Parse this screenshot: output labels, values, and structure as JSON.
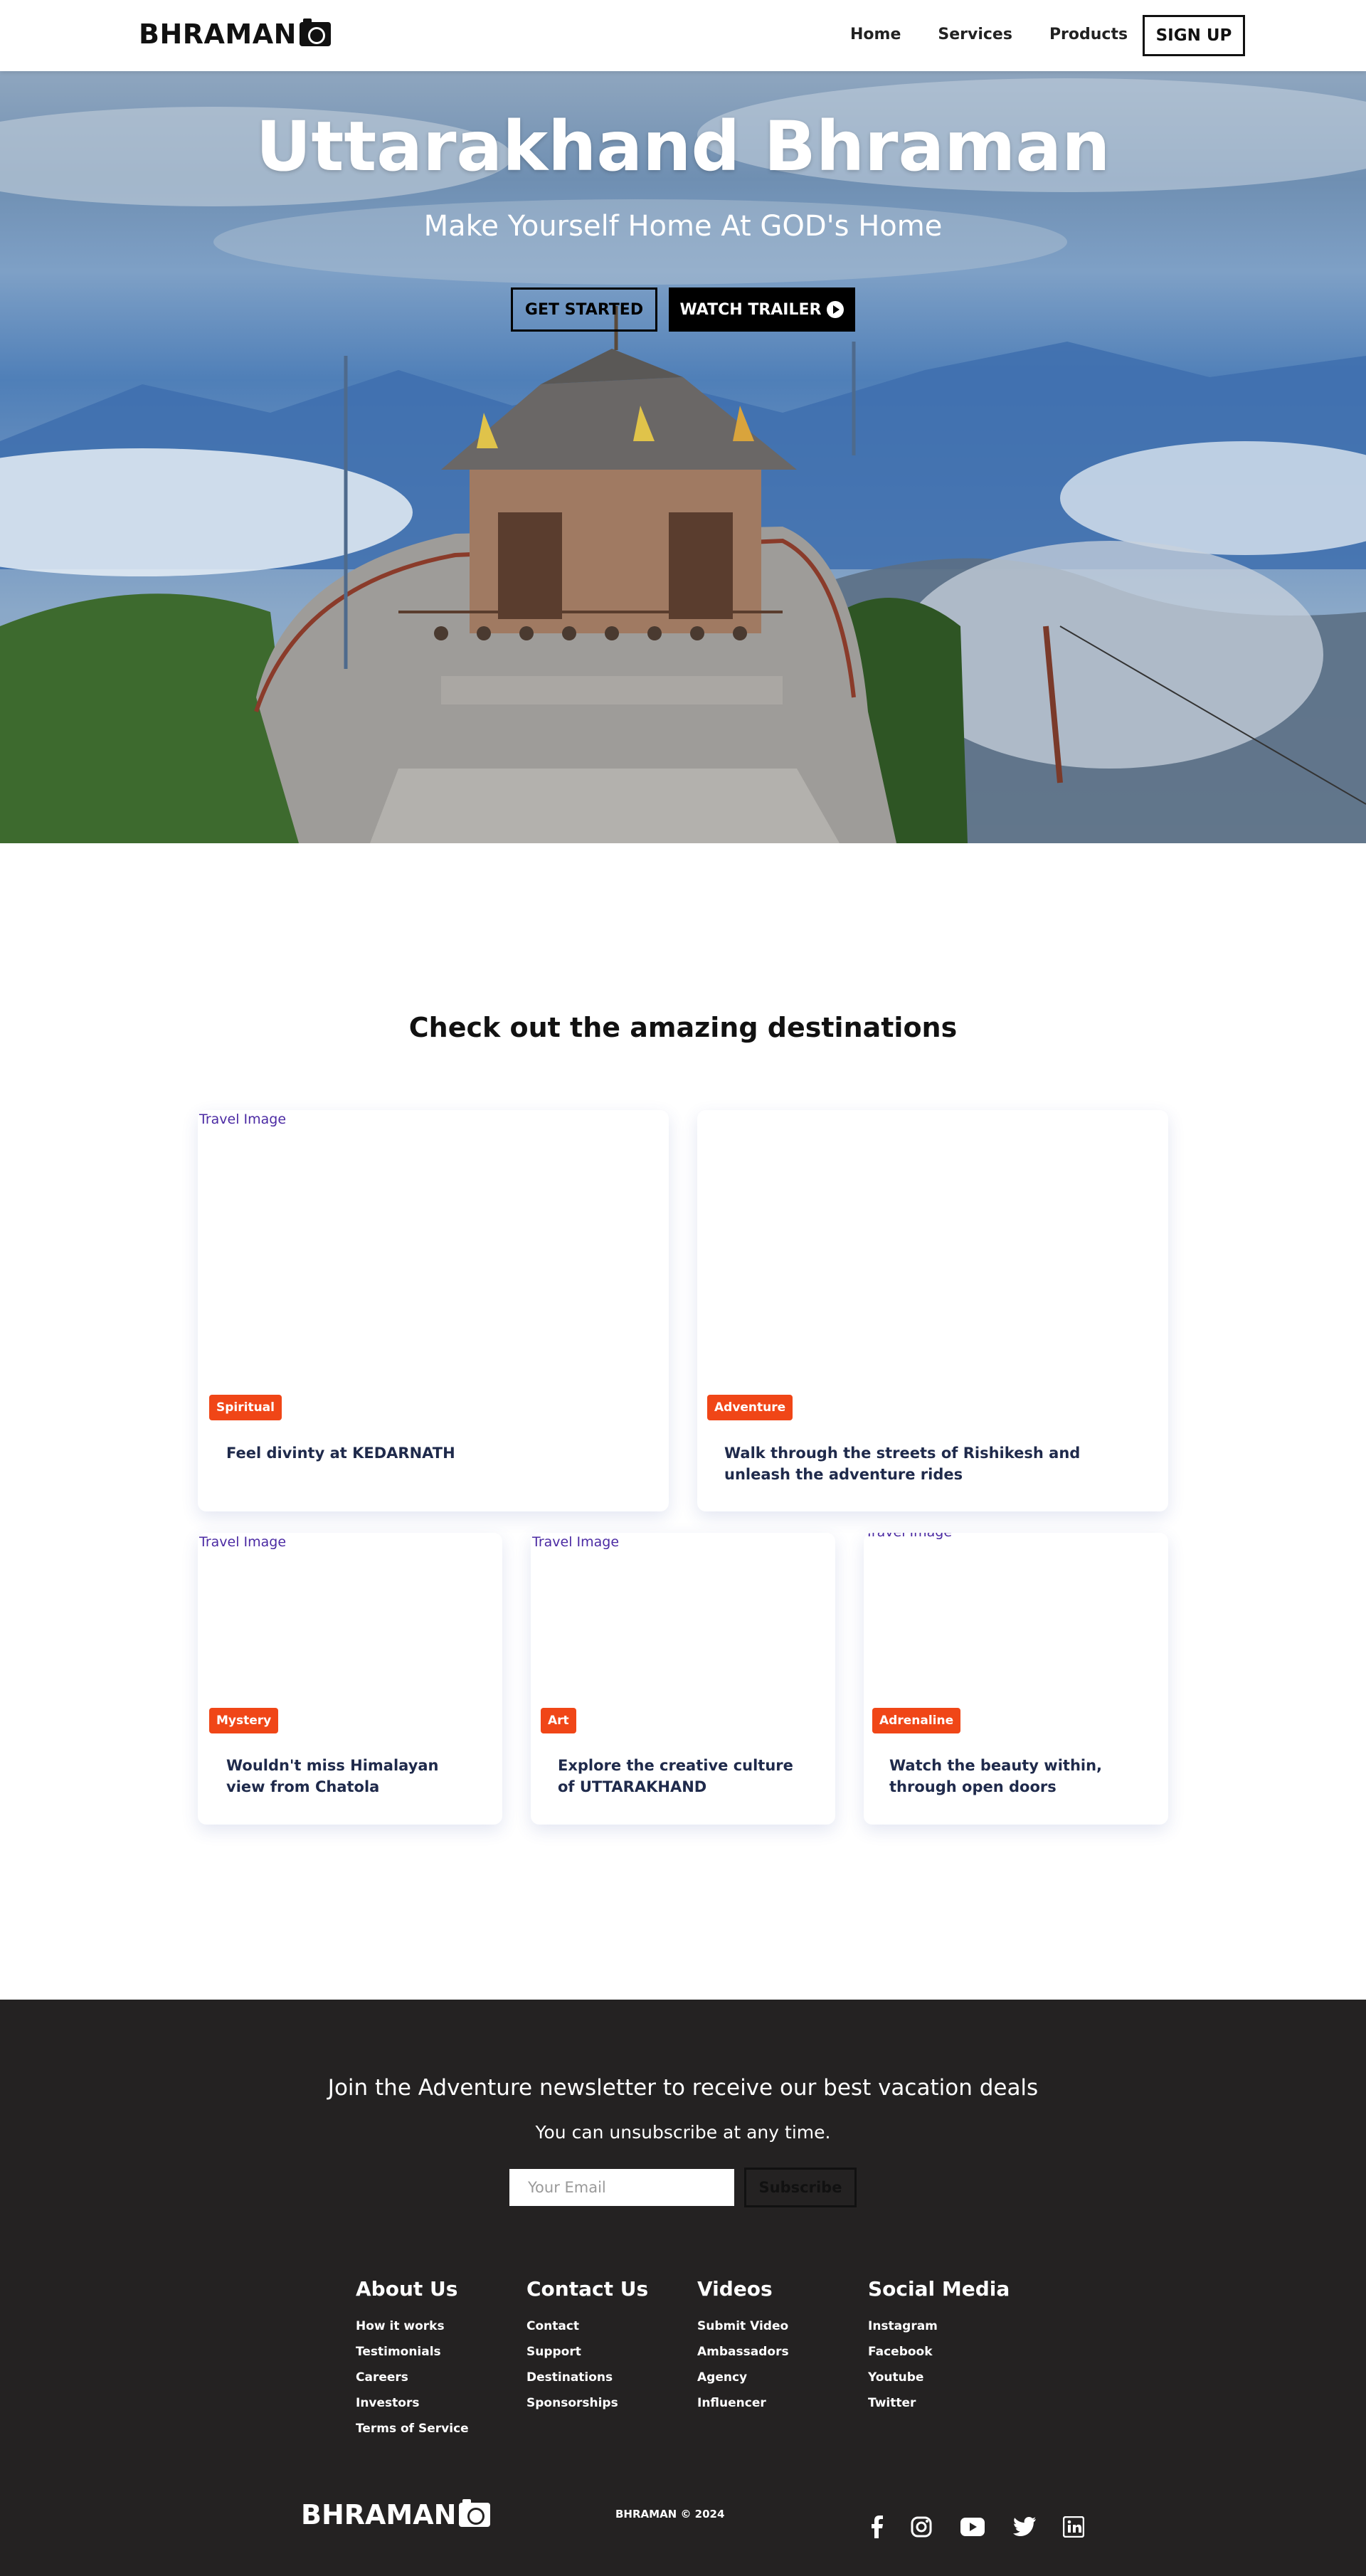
{
  "nav": {
    "brand": "BHRAMAN",
    "links": [
      "Home",
      "Services",
      "Products"
    ],
    "signup": "SIGN UP"
  },
  "hero": {
    "title": "Uttarakhand Bhraman",
    "subtitle": "Make Yourself Home At GOD's Home",
    "get_started": "GET STARTED",
    "watch_trailer": "WATCH TRAILER"
  },
  "destinations": {
    "title": "Check out the amazing destinations",
    "cards": [
      {
        "img_alt": "Travel Image",
        "badge": "Spiritual",
        "text": "Feel divinty at KEDARNATH"
      },
      {
        "img_alt": "",
        "badge": "Adventure",
        "text": "Walk through the streets of Rishikesh and unleash the adventure rides"
      },
      {
        "img_alt": "Travel Image",
        "badge": "Mystery",
        "text": "Wouldn't miss Himalayan view from Chatola"
      },
      {
        "img_alt": "Travel Image",
        "badge": "Art",
        "text": "Explore the creative culture of UTTARAKHAND"
      },
      {
        "img_alt": "Travel Image",
        "badge": "Adrenaline",
        "text": "Watch the beauty within, through open doors"
      }
    ]
  },
  "footer": {
    "newsletter_title": "Join the Adventure newsletter to receive our best vacation deals",
    "newsletter_sub": "You can unsubscribe at any time.",
    "email_placeholder": "Your Email",
    "subscribe": "Subscribe",
    "columns": [
      {
        "title": "About Us",
        "links": [
          "How it works",
          "Testimonials",
          "Careers",
          "Investors",
          "Terms of Service"
        ]
      },
      {
        "title": "Contact Us",
        "links": [
          "Contact",
          "Support",
          "Destinations",
          "Sponsorships"
        ]
      },
      {
        "title": "Videos",
        "links": [
          "Submit Video",
          "Ambassadors",
          "Agency",
          "Influencer"
        ]
      },
      {
        "title": "Social Media",
        "links": [
          "Instagram",
          "Facebook",
          "Youtube",
          "Twitter"
        ]
      }
    ],
    "brand": "BHRAMAN",
    "copyright": "BHRAMAN © 2024",
    "social_icons": [
      "facebook-icon",
      "instagram-icon",
      "youtube-icon",
      "twitter-icon",
      "linkedin-icon"
    ]
  },
  "colors": {
    "badge": "#f04617",
    "footer_bg": "#242222",
    "card_text": "#1f2a4b"
  }
}
